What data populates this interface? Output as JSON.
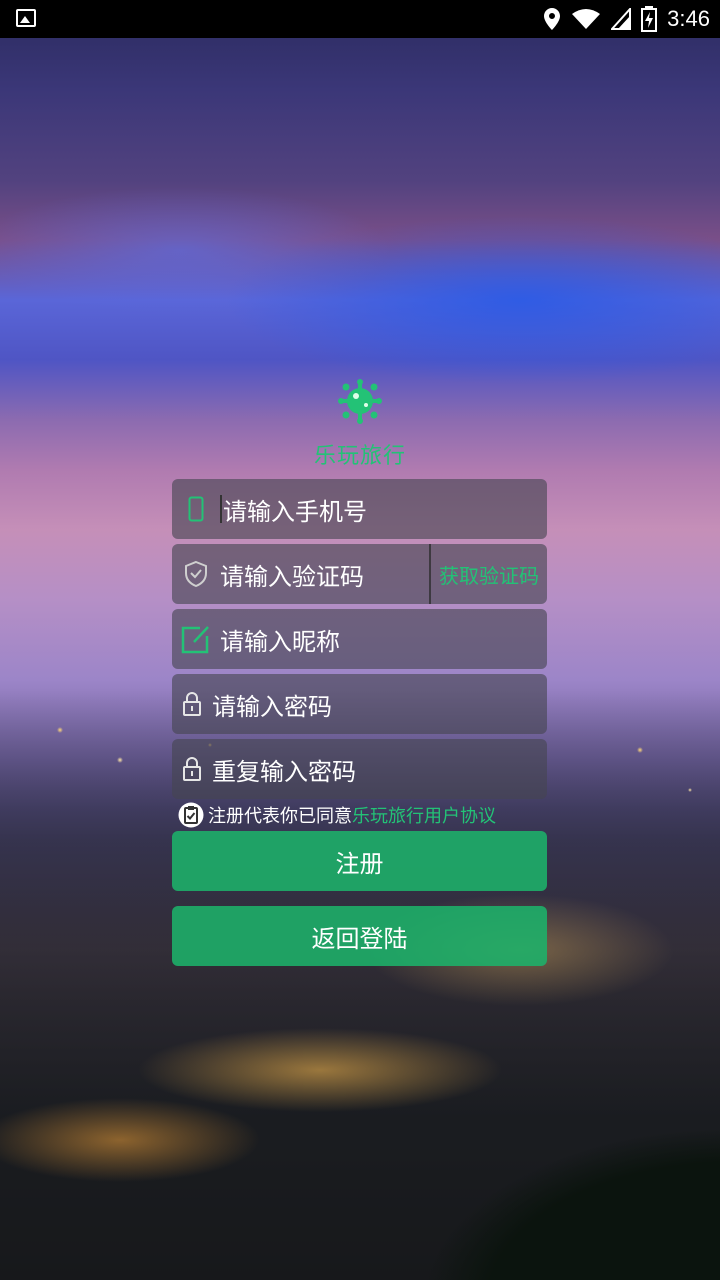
{
  "status_bar": {
    "time": "3:46",
    "icons": [
      "picture-icon",
      "location-icon",
      "wifi-icon",
      "signal-icon",
      "battery-icon"
    ]
  },
  "app": {
    "title": "乐玩旅行",
    "accent_color": "#23c276"
  },
  "form": {
    "phone_placeholder": "请输入手机号",
    "code_placeholder": "请输入验证码",
    "get_code_label": "获取验证码",
    "nickname_placeholder": "请输入昵称",
    "password_placeholder": "请输入密码",
    "repeat_password_placeholder": "重复输入密码"
  },
  "agreement": {
    "text": "注册代表你已同意",
    "link": "乐玩旅行用户协议"
  },
  "buttons": {
    "register": "注册",
    "back_login": "返回登陆"
  }
}
